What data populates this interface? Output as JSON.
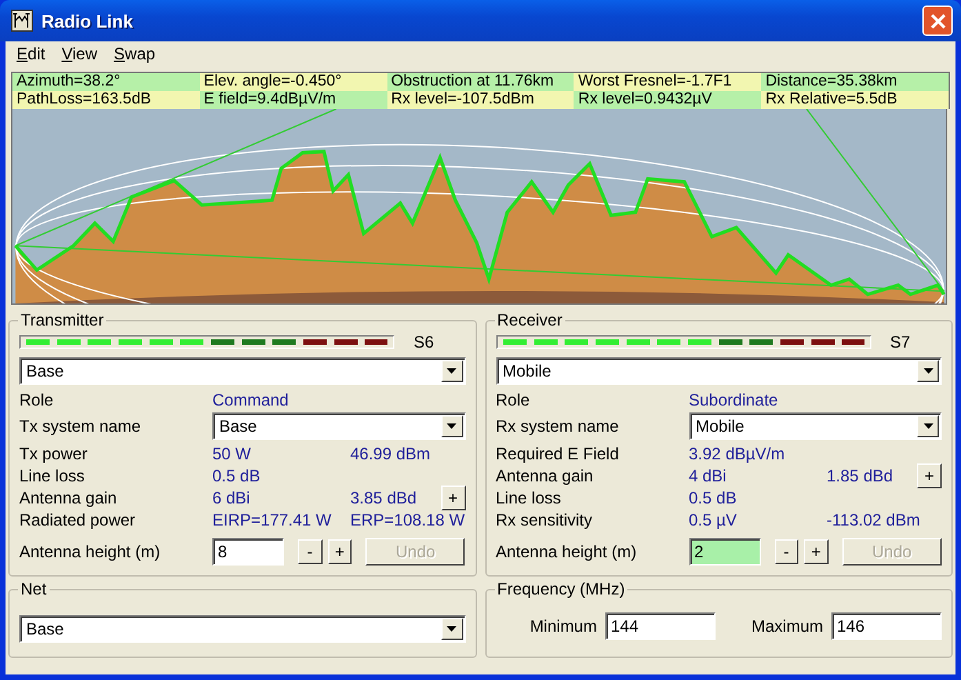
{
  "window": {
    "title": "Radio Link"
  },
  "menu": [
    {
      "label": "Edit"
    },
    {
      "label": "View"
    },
    {
      "label": "Swap"
    }
  ],
  "summary": [
    [
      "Azimuth=38.2°",
      "Elev. angle=-0.450°",
      "Obstruction at 11.76km",
      "Worst Fresnel=-1.7F1",
      "Distance=35.38km"
    ],
    [
      "PathLoss=163.5dB",
      "E field=9.4dBµV/m",
      "Rx level=-107.5dBm",
      "Rx level=0.9432µV",
      "Rx Relative=5.5dB"
    ]
  ],
  "panels": [
    {
      "title": "Transmitter",
      "meter": {
        "level": 0.5,
        "reading": "S6"
      },
      "preset": "Base",
      "rows": [
        {
          "kind": "value",
          "label": "Role",
          "value": "Command"
        },
        {
          "kind": "select",
          "label": "Tx system name",
          "value": "Base"
        },
        {
          "kind": "value",
          "label": "Tx power",
          "value": "50 W",
          "value2": "46.99 dBm"
        },
        {
          "kind": "value",
          "label": "Line loss",
          "value": "0.5 dB"
        },
        {
          "kind": "value",
          "label": "Antenna gain",
          "value": "6 dBi",
          "value2": "3.85 dBd",
          "button": "+"
        },
        {
          "kind": "value",
          "label": "Radiated power",
          "value": "EIRP=177.41 W",
          "value2": "ERP=108.18 W"
        }
      ],
      "height": {
        "label": "Antenna height (m)",
        "value": "8",
        "modified": false,
        "minus": "-",
        "plus": "+",
        "undo": "Undo",
        "undo_disabled": true
      }
    },
    {
      "title": "Receiver",
      "meter": {
        "level": 0.5833,
        "reading": "S7"
      },
      "preset": "Mobile",
      "rows": [
        {
          "kind": "value",
          "label": "Role",
          "value": "Subordinate"
        },
        {
          "kind": "select",
          "label": "Rx system name",
          "value": "Mobile"
        },
        {
          "kind": "value",
          "label": "Required E Field",
          "value": "3.92 dBµV/m"
        },
        {
          "kind": "value",
          "label": "Antenna gain",
          "value": "4 dBi",
          "value2": "1.85 dBd",
          "button": "+"
        },
        {
          "kind": "value",
          "label": "Line loss",
          "value": "0.5 dB"
        },
        {
          "kind": "value",
          "label": "Rx sensitivity",
          "value": "0.5 µV",
          "value2": "-113.02 dBm"
        }
      ],
      "height": {
        "label": "Antenna height (m)",
        "value": "2",
        "modified": true,
        "minus": "-",
        "plus": "+",
        "undo": "Undo",
        "undo_disabled": true
      }
    }
  ],
  "net": {
    "title": "Net",
    "value": "Base"
  },
  "frequency": {
    "title": "Frequency (MHz)",
    "minimum_label": "Minimum",
    "minimum": "144",
    "maximum_label": "Maximum",
    "maximum": "146"
  }
}
